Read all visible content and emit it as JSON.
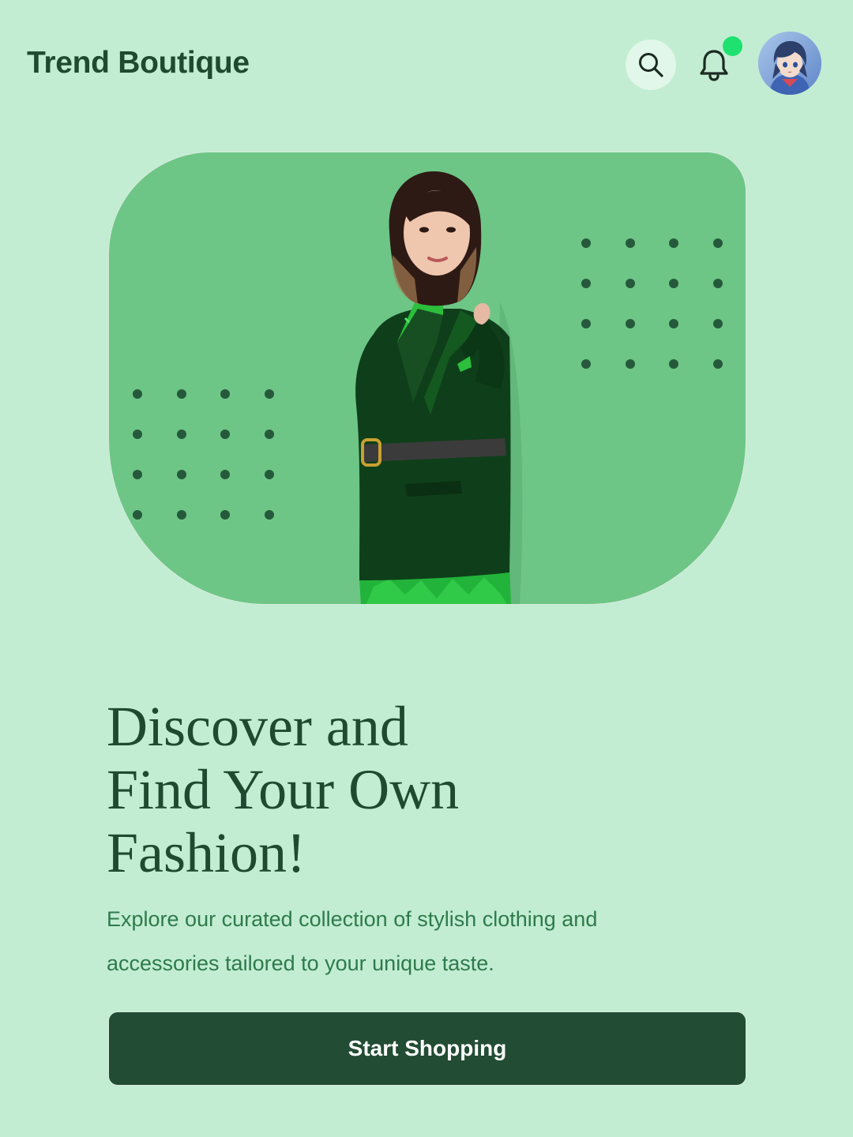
{
  "header": {
    "title": "Trend Boutique",
    "icons": {
      "search": "search-icon",
      "notifications": "bell-icon",
      "avatar": "user-avatar"
    }
  },
  "hero": {
    "image": "model-in-green-blazer"
  },
  "content": {
    "headline_line1": "Discover and",
    "headline_line2": "Find Your Own",
    "headline_line3": "Fashion!",
    "description": "Explore our curated collection of stylish clothing and accessories tailored to your unique taste.",
    "cta_label": "Start Shopping"
  },
  "colors": {
    "background": "#c2edd3",
    "hero_panel": "#6dc686",
    "primary_dark": "#224c33",
    "text_dark": "#1f4a31",
    "text_body": "#2e7a4b",
    "notification_dot": "#1fe16f"
  }
}
